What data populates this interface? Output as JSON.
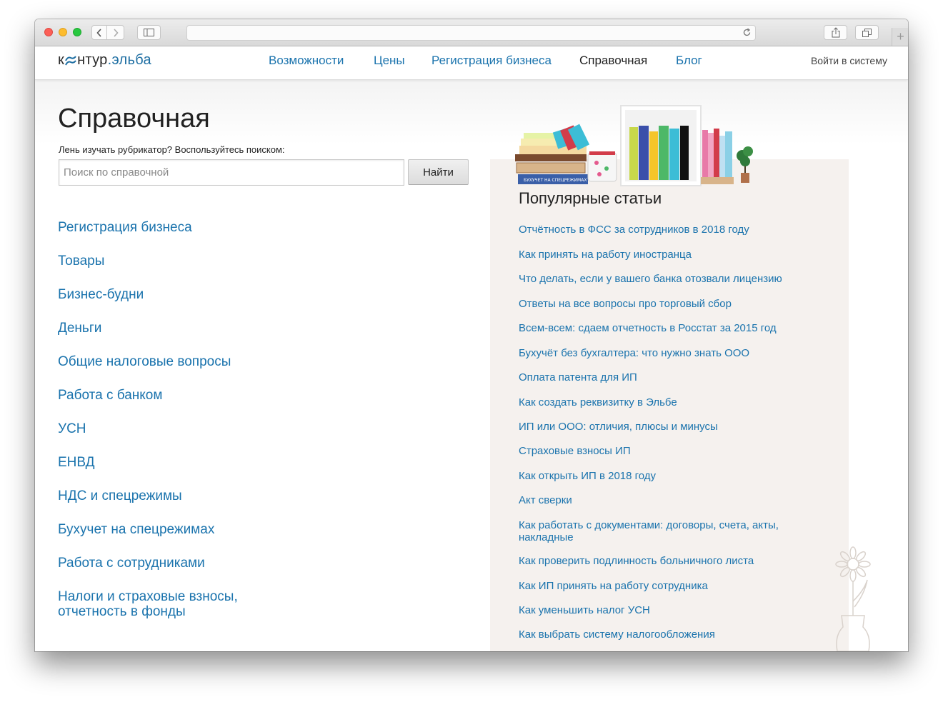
{
  "browser": {
    "url": ""
  },
  "site": {
    "logo_prefix": "к",
    "logo_suffix": "нтур",
    "logo_accent": ".эльба",
    "nav": [
      {
        "label": "Возможности",
        "active": false
      },
      {
        "label": "Цены",
        "active": false
      },
      {
        "label": "Регистрация бизнеса",
        "active": false
      },
      {
        "label": "Справочная",
        "active": true
      },
      {
        "label": "Блог",
        "active": false
      }
    ],
    "login_label": "Войти в систему"
  },
  "main": {
    "title": "Справочная",
    "search_hint": "Лень изучать рубрикатор? Воспользуйтесь поиском:",
    "search_placeholder": "Поиск по справочной",
    "search_value": "",
    "search_button": "Найти",
    "categories": [
      "Регистрация бизнеса",
      "Товары",
      "Бизнес-будни",
      "Деньги",
      "Общие налоговые вопросы",
      "Работа с банком",
      "УСН",
      "ЕНВД",
      "НДС и спецрежимы",
      "Бухучет на спецрежимах",
      "Работа с сотрудниками",
      "Налоги и страховые взносы,\nотчетность в фонды"
    ]
  },
  "sidebar": {
    "title": "Популярные статьи",
    "articles": [
      "Отчётность в ФСС за сотрудников в 2018 году",
      "Как принять на работу иностранца",
      "Что делать, если у вашего банка отозвали лицензию",
      "Ответы на все вопросы про торговый сбор",
      "Всем-всем: сдаем отчетность в Росстат за 2015 год",
      "Бухучёт без бухгалтера: что нужно знать ООО",
      "Оплата патента для ИП",
      "Как создать реквизитку в Эльбе",
      "ИП или ООО: отличия, плюсы и минусы",
      "Страховые взносы ИП",
      "Как открыть ИП в 2018 году",
      "Акт сверки",
      "Как работать с документами: договоры, счета, акты, накладные",
      "Как проверить подлинность больничного листа",
      "Как ИП принять на работу сотрудника",
      "Как уменьшить налог УСН",
      "Как выбрать систему налогообложения"
    ],
    "book_spine_label": "БУХУЧЕТ НА СПЕЦРЕЖИМАХ"
  },
  "colors": {
    "link": "#1a73ad",
    "sidebar_bg": "#f5f1ee"
  }
}
